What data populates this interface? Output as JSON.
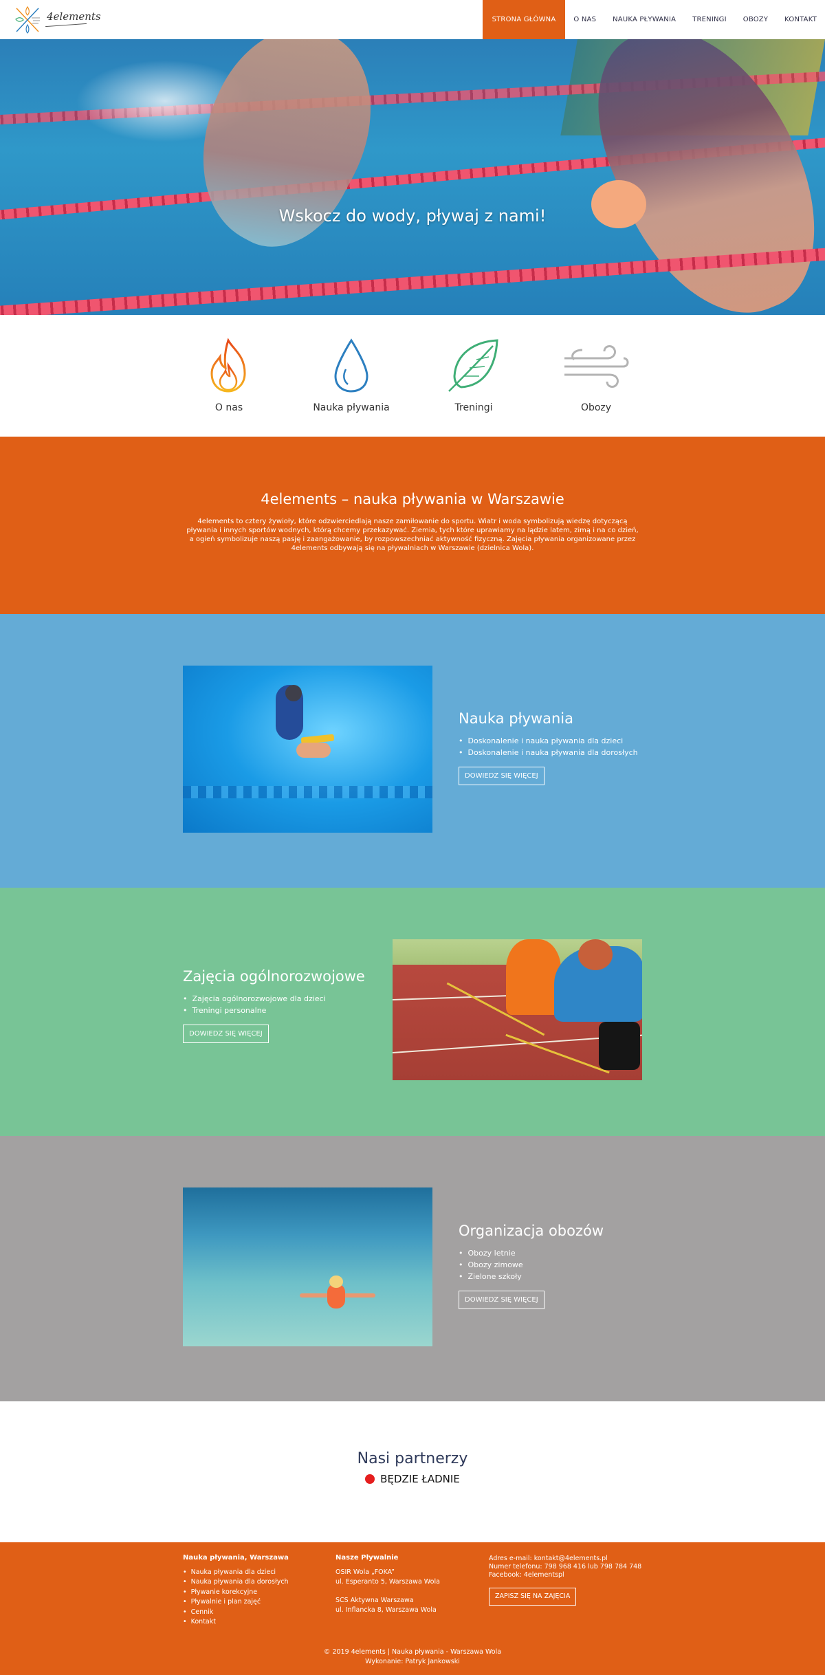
{
  "header": {
    "logo_text": "4elements",
    "nav": [
      {
        "label": "STRONA GŁÓWNA",
        "active": true
      },
      {
        "label": "O NAS"
      },
      {
        "label": "NAUKA PŁYWANIA"
      },
      {
        "label": "TRENINGI"
      },
      {
        "label": "OBOZY"
      },
      {
        "label": "KONTAKT"
      }
    ]
  },
  "hero": {
    "title": "Wskocz do wody, pływaj z nami!"
  },
  "features": [
    {
      "label": "O nas",
      "icon": "fire-icon",
      "color": "#f0901e"
    },
    {
      "label": "Nauka pływania",
      "icon": "water-drop-icon",
      "color": "#2c7fc0"
    },
    {
      "label": "Treningi",
      "icon": "leaf-icon",
      "color": "#3fae76"
    },
    {
      "label": "Obozy",
      "icon": "wind-icon",
      "color": "#b3b3b3"
    }
  ],
  "about": {
    "title": "4elements – nauka pływania w Warszawie",
    "text": "4elements to cztery żywioły, które odzwierciedlają nasze zamiłowanie do sportu. Wiatr i woda symbolizują wiedzę dotyczącą pływania i innych sportów wodnych, którą chcemy przekazywać. Ziemia, tych które uprawiamy na lądzie latem, zimą i na co dzień, a ogień symbolizuje naszą pasję i zaangażowanie, by rozpowszechniać aktywność fizyczną. Zajęcia pływania organizowane przez 4elements odbywają się na pływalniach w Warszawie (dzielnica Wola)."
  },
  "sections": {
    "swimming": {
      "title": "Nauka pływania",
      "items": [
        "Doskonalenie i nauka pływania dla dzieci",
        "Doskonalenie i nauka pływania dla dorosłych"
      ],
      "button": "DOWIEDZ SIĘ WIĘCEJ"
    },
    "general": {
      "title": "Zajęcia ogólnorozwojowe",
      "items": [
        "Zajęcia ogólnorozwojowe dla dzieci",
        "Treningi personalne"
      ],
      "button": "DOWIEDZ SIĘ WIĘCEJ"
    },
    "camps": {
      "title": "Organizacja obozów",
      "items": [
        "Obozy letnie",
        "Obozy zimowe",
        "Zielone szkoły"
      ],
      "button": "DOWIEDZ SIĘ WIĘCEJ"
    }
  },
  "partners": {
    "title": "Nasi partnerzy",
    "item": "BĘDZIE ŁADNIE"
  },
  "footer": {
    "col1": {
      "title": "Nauka pływania, Warszawa",
      "links": [
        "Nauka pływania dla dzieci",
        "Nauka pływania dla dorosłych",
        "Pływanie korekcyjne",
        "Pływalnie i plan zajęć",
        "Cennik",
        "Kontakt"
      ]
    },
    "col2": {
      "title": "Nasze Pływalnie",
      "pool1_name": "OSIR Wola „FOKA”",
      "pool1_address": "ul. Esperanto 5, Warszawa Wola",
      "pool2_name": "SCS Aktywna Warszawa",
      "pool2_address": "ul. Inflancka 8, Warszawa Wola"
    },
    "col3": {
      "email": "Adres e-mail: kontakt@4elements.pl",
      "phone": "Numer telefonu: 798 968 416 lub 798 784 748",
      "facebook": "Facebook: 4elementspl",
      "button": "ZAPISZ SIĘ NA ZAJĘCIA"
    },
    "copyright": "© 2019 4elements | Nauka pływania - Warszawa Wola",
    "author": "Wykonanie: Patryk Jankowski"
  }
}
